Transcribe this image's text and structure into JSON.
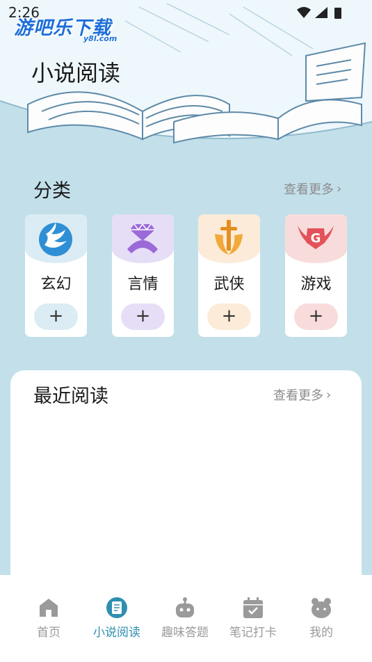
{
  "status_bar": {
    "time": "2:26"
  },
  "watermark": {
    "main": "游吧乐下载",
    "sub": "y8l.com"
  },
  "header": {
    "title": "小说阅读"
  },
  "categories_section": {
    "title": "分类",
    "see_more": "查看更多",
    "items": [
      {
        "label": "玄幻",
        "add": "+",
        "icon": "phoenix-icon",
        "tint": "#dcecf4",
        "btn": "#dcecf4",
        "color": "#2f8fd6"
      },
      {
        "label": "言情",
        "add": "+",
        "icon": "diamond-ring-icon",
        "tint": "#e6def7",
        "btn": "#e6def7",
        "color": "#9b6ad8"
      },
      {
        "label": "武侠",
        "add": "+",
        "icon": "sword-icon",
        "tint": "#fbebd8",
        "btn": "#fbebd8",
        "color": "#f2a93b"
      },
      {
        "label": "游戏",
        "add": "+",
        "icon": "game-badge-icon",
        "tint": "#f8dcdc",
        "btn": "#f8dcdc",
        "color": "#e3525a"
      }
    ]
  },
  "recent_section": {
    "title": "最近阅读",
    "see_more": "查看更多"
  },
  "tabbar": {
    "items": [
      {
        "label": "首页",
        "icon": "home-icon",
        "active": false
      },
      {
        "label": "小说阅读",
        "icon": "book-icon",
        "active": true
      },
      {
        "label": "趣味答题",
        "icon": "robot-icon",
        "active": false
      },
      {
        "label": "笔记打卡",
        "icon": "calendar-check-icon",
        "active": false
      },
      {
        "label": "我的",
        "icon": "profile-icon",
        "active": false
      }
    ]
  },
  "colors": {
    "background": "#c3e0ea",
    "accent": "#2e8fb0",
    "inactive": "#9a9a9a"
  }
}
